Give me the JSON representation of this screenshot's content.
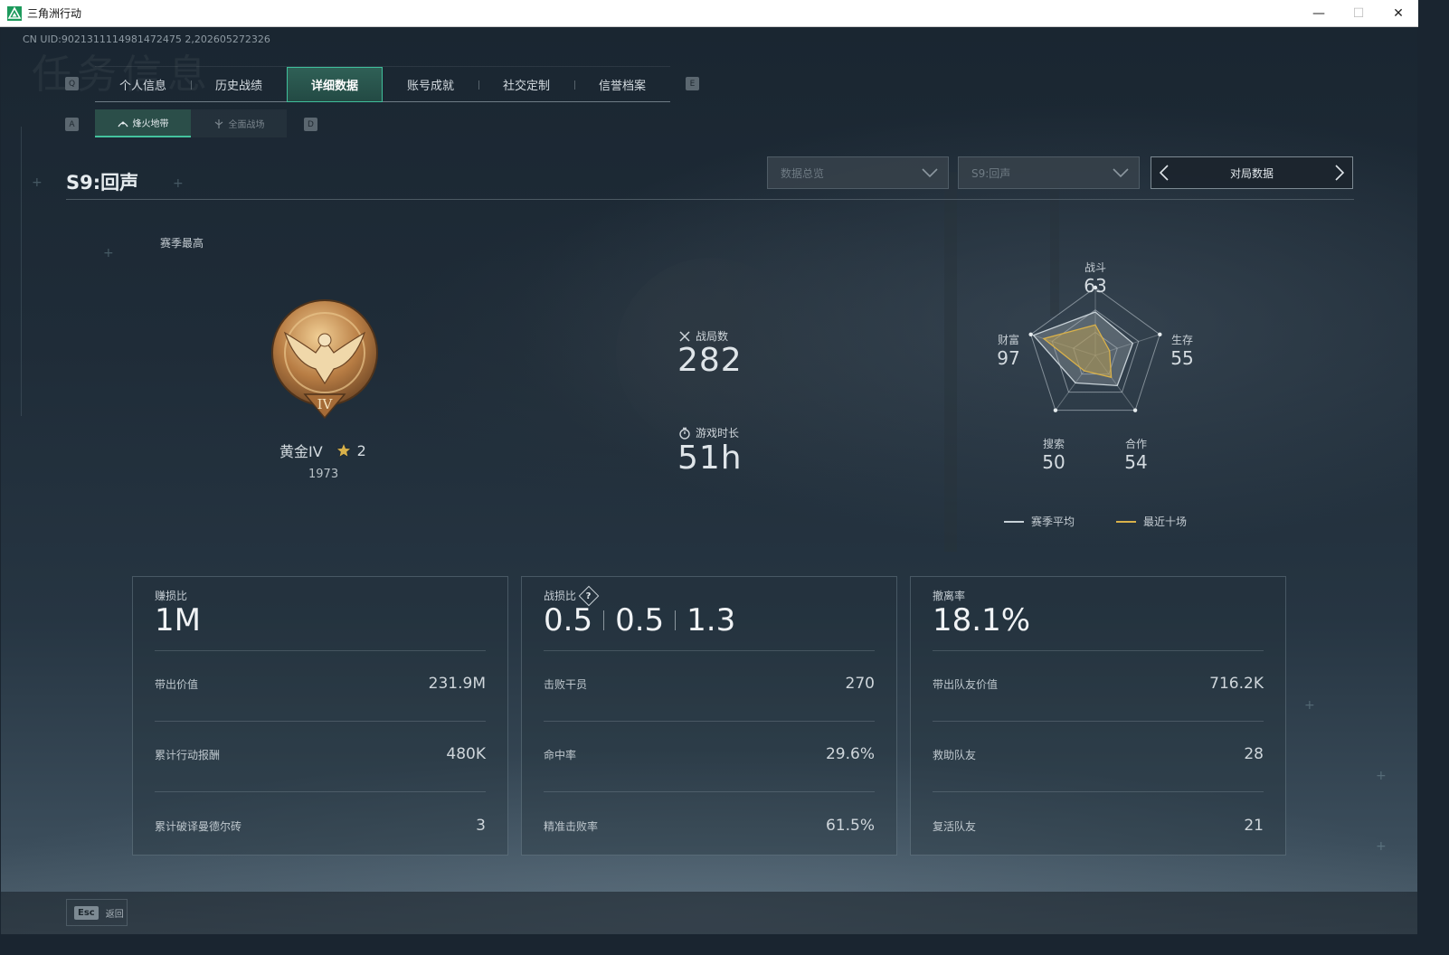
{
  "window": {
    "title": "三角洲行动",
    "minimize": "—",
    "maximize": "☐",
    "close": "✕"
  },
  "uid": "CN UID:9021311114981472475 2,202605272326",
  "bg_watermark": "任务信息",
  "tabs": {
    "key_left": "Q",
    "key_right": "E",
    "items": [
      {
        "label": "个人信息"
      },
      {
        "label": "历史战绩"
      },
      {
        "label": "详细数据",
        "active": true
      },
      {
        "label": "账号成就"
      },
      {
        "label": "社交定制"
      },
      {
        "label": "信誉档案"
      }
    ]
  },
  "subtabs": {
    "key_left": "A",
    "key_right": "D",
    "items": [
      {
        "label": "烽火地带",
        "icon": "hazard-zone-icon",
        "active": true
      },
      {
        "label": "全面战场",
        "icon": "battlefield-icon"
      }
    ]
  },
  "season": {
    "title": "S9:回声"
  },
  "filters": {
    "data_view": "数据总览",
    "season_select": "S9:回声",
    "pager_label": "对局数据"
  },
  "rank": {
    "section_label": "赛季最高",
    "name": "黄金IV",
    "badge_numeral": "IV",
    "stars": "2",
    "score": "1973"
  },
  "summary": {
    "matches_label": "战局数",
    "matches_value": "282",
    "playtime_label": "游戏时长",
    "playtime_value": "51h"
  },
  "radar": {
    "axes": [
      {
        "label": "战斗",
        "value": "63"
      },
      {
        "label": "生存",
        "value": "55"
      },
      {
        "label": "合作",
        "value": "54"
      },
      {
        "label": "搜索",
        "value": "50"
      },
      {
        "label": "财富",
        "value": "97"
      }
    ],
    "season_avg_values": [
      0.64,
      0.58,
      0.55,
      0.5,
      0.96
    ],
    "recent_ten_values": [
      0.45,
      0.22,
      0.4,
      0.28,
      0.8
    ],
    "legend": {
      "season_avg": "赛季平均",
      "recent_ten": "最近十场"
    },
    "colors": {
      "season_avg": "#c8d2d8",
      "recent_ten": "#d9b14a",
      "fill": "#b59a54"
    }
  },
  "cards": [
    {
      "label": "赚损比",
      "big": "1M",
      "rows": [
        {
          "label": "带出价值",
          "value": "231.9M"
        },
        {
          "label": "累计行动报酬",
          "value": "480K"
        },
        {
          "label": "累计破译曼德尔砖",
          "value": "3"
        }
      ]
    },
    {
      "label": "战损比",
      "help_icon": "question-diamond-icon",
      "big_parts": [
        "0.5",
        "0.5",
        "1.3"
      ],
      "rows": [
        {
          "label": "击败干员",
          "value": "270"
        },
        {
          "label": "命中率",
          "value": "29.6%"
        },
        {
          "label": "精准击败率",
          "value": "61.5%"
        }
      ]
    },
    {
      "label": "撤离率",
      "big": "18.1%",
      "rows": [
        {
          "label": "带出队友价值",
          "value": "716.2K"
        },
        {
          "label": "救助队友",
          "value": "28"
        },
        {
          "label": "复活队友",
          "value": "21"
        }
      ]
    }
  ],
  "footer": {
    "esc_key": "Esc",
    "back_label": "返回"
  }
}
